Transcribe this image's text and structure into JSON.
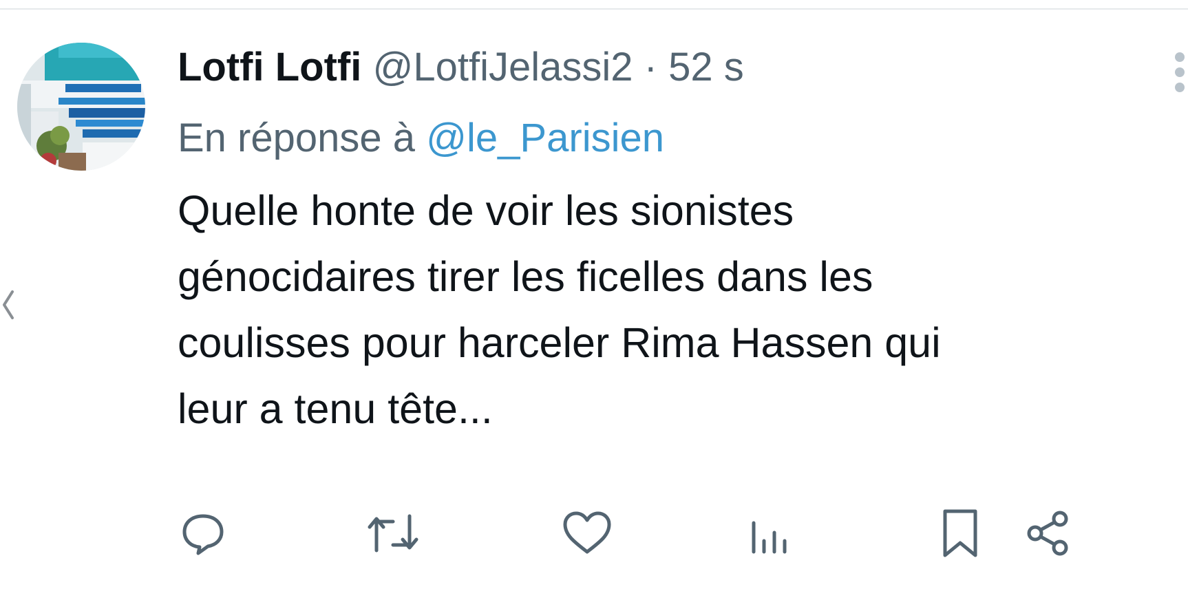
{
  "tweet": {
    "display_name": "Lotfi Lotfi",
    "handle": "@LotfiJelassi2",
    "separator": "·",
    "timestamp": "52 s",
    "reply_prefix": "En réponse à",
    "reply_to": "@le_Parisien",
    "text_lines": [
      "Quelle honte de voir les sionistes",
      "génocidaires tirer les ficelles dans les",
      "coulisses pour harceler Rima Hassen qui",
      "leur a tenu tête..."
    ]
  },
  "actions": [
    {
      "icon": "reply-icon"
    },
    {
      "icon": "retweet-icon"
    },
    {
      "icon": "like-icon"
    },
    {
      "icon": "views-icon"
    },
    {
      "icon": "bookmark-icon"
    },
    {
      "icon": "share-icon"
    }
  ],
  "colors": {
    "primary_text": "#0f1419",
    "secondary_text": "#536471",
    "mention": "#3c97cf",
    "divider": "#e6e9eb"
  }
}
